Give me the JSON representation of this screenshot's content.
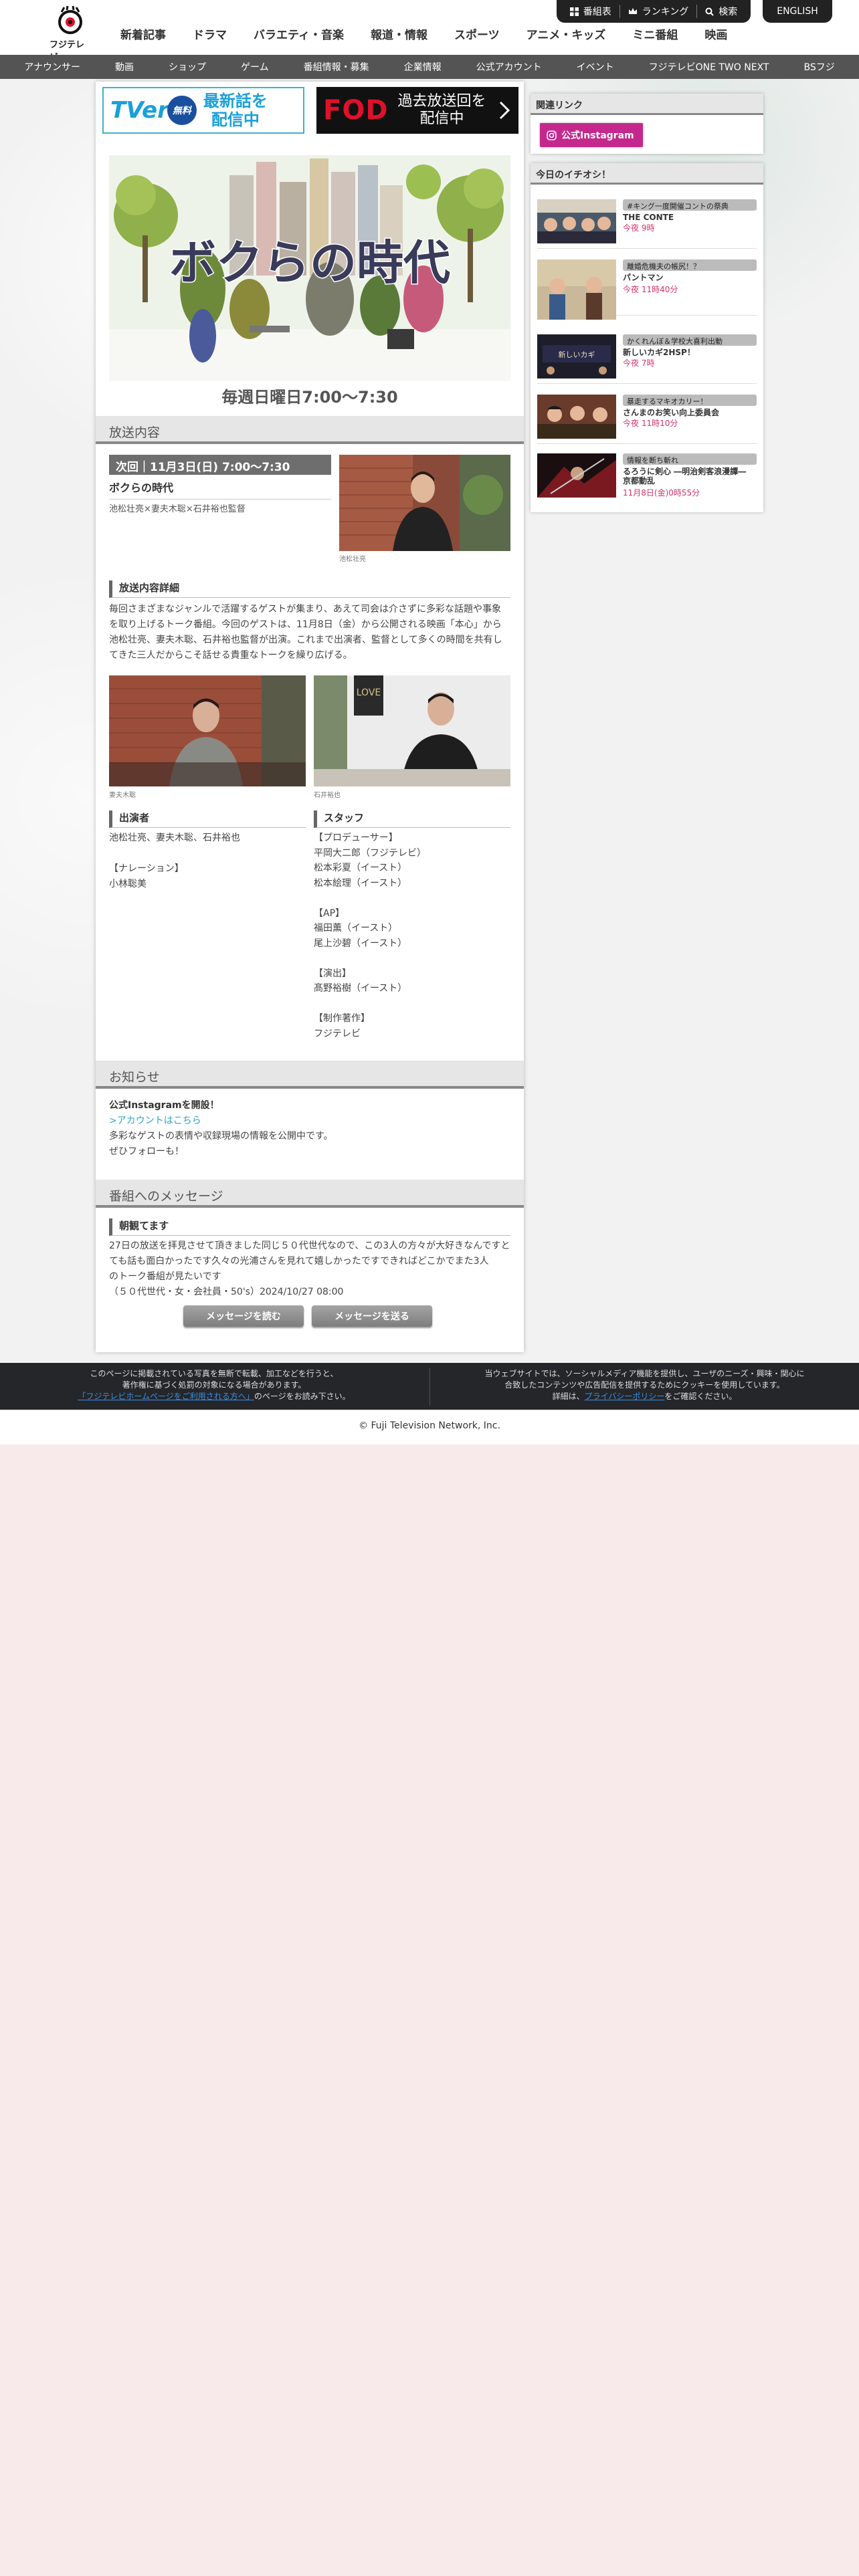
{
  "header": {
    "logo_text": "フジテレビ",
    "nav": [
      "新着記事",
      "ドラマ",
      "バラエティ・音楽",
      "報道・情報",
      "スポーツ",
      "アニメ・キッズ",
      "ミニ番組",
      "映画"
    ],
    "util": {
      "program_guide": "番組表",
      "ranking": "ランキング",
      "search": "検索"
    },
    "english": "ENGLISH"
  },
  "subnav": [
    "アナウンサー",
    "動画",
    "ショップ",
    "ゲーム",
    "番組情報・募集",
    "企業情報",
    "公式アカウント",
    "イベント",
    "フジテレビONE TWO NEXT",
    "BSフジ"
  ],
  "banners": {
    "tver_logo": "TVer",
    "tver_free": "無料",
    "tver_line1": "最新話を",
    "tver_line2": "配信中",
    "fod_logo": "FOD",
    "fod_line1": "過去放送回を",
    "fod_line2": "配信中"
  },
  "hero": {
    "logo": "ボクらの時代",
    "schedule": "毎週日曜日7:00〜7:30"
  },
  "broadcast": {
    "heading": "放送内容",
    "next": "次回｜11月3日(日) 7:00〜7:30",
    "title": "ボクらの時代",
    "cast": "池松壮亮×妻夫木聡×石井裕也監督",
    "photo_caption": "池松壮亮",
    "detail_heading": "放送内容詳細",
    "detail_lines": [
      "毎回さまざまなジャンルで活躍するゲストが集まり、あえて司会は介さずに多彩な話題や事象",
      "を取り上げるトーク番組。今回のゲストは、11月8日（金）から公開される映画「本心」から",
      "池松壮亮、妻夫木聡、石井裕也監督が出演。これまで出演者、監督として多くの時間を共有し",
      "てきた三人だからこそ話せる貴重なトークを繰り広げる。"
    ],
    "photo2_caption": "妻夫木聡",
    "photo3_caption": "石井裕也",
    "performers_heading": "出演者",
    "performers": [
      "池松壮亮、妻夫木聡、石井裕也",
      "",
      "【ナレーション】",
      "小林聡美"
    ],
    "staff_heading": "スタッフ",
    "staff": [
      "【プロデューサー】",
      "平岡大二郎（フジテレビ）",
      "松本彩夏（イースト）",
      "松本絵理（イースト）",
      "",
      "【AP】",
      "福田薫（イースト）",
      "尾上沙碧（イースト）",
      "",
      "【演出】",
      "髙野裕樹（イースト）",
      "",
      "【制作著作】",
      "フジテレビ"
    ]
  },
  "notice": {
    "heading": "お知らせ",
    "title": "公式Instagramを開設！",
    "link": ">アカウントはこちら",
    "line1": "多彩なゲストの表情や収録現場の情報を公開中です。",
    "line2": "ぜひフォローも！"
  },
  "messages": {
    "heading": "番組へのメッセージ",
    "msg_title": "朝観てます",
    "msg_lines": [
      "27日の放送を拝見させて頂きました同じ５０代世代なので、この3人の方々が大好きなんですと",
      "ても話も面白かったです久々の光浦さんを見れて嬉しかったですできればどこかでまた3人",
      "のトーク番組が見たいです"
    ],
    "msg_meta": "（５０代世代・女・会社員・50's）2024/10/27 08:00",
    "read_button": "メッセージを読む",
    "send_button": "メッセージを送る"
  },
  "sidebar": {
    "links_heading": "関連リンク",
    "instagram": "公式Instagram",
    "pick_heading": "今日のイチオシ！",
    "picks": [
      {
        "tag": "#キング一度開催コントの祭典",
        "title": "THE CONTE",
        "time": "今夜 9時"
      },
      {
        "tag": "離婚危機夫の帳尻！？",
        "title": "パントマン",
        "time": "今夜 11時40分"
      },
      {
        "tag": "かくれんぼ＆学校大喜利出動",
        "title": "新しいカギ2HSP！",
        "time": "今夜 7時"
      },
      {
        "tag": "暴走するマキオカリー！",
        "title": "さんまのお笑い向上委員会",
        "time": "今夜 11時10分"
      },
      {
        "tag": "情報を断ち斬れ",
        "title": "るろうに剣心 ―明治剣客浪漫譚― 京都動乱",
        "time": "11月8日(金)0時55分"
      }
    ]
  },
  "footer": {
    "left_line1": "このページに掲載されている写真を無断で転載、加工などを行うと、",
    "left_line2": "著作権に基づく処罰の対象になる場合があります。",
    "left_link": "「フジテレビホームページをご利用される方へ」",
    "left_line3": "のページをお読み下さい。",
    "right_line1": "当ウェブサイトでは、ソーシャルメディア機能を提供し、ユーザのニーズ・興味・関心に",
    "right_line2": "合致したコンテンツや広告配信を提供するためにクッキーを使用しています。",
    "right_pre": "詳細は、",
    "right_link": "プライバシーポリシー",
    "right_post": "をご確認ください。",
    "copyright": "© Fuji Television Network, Inc."
  }
}
